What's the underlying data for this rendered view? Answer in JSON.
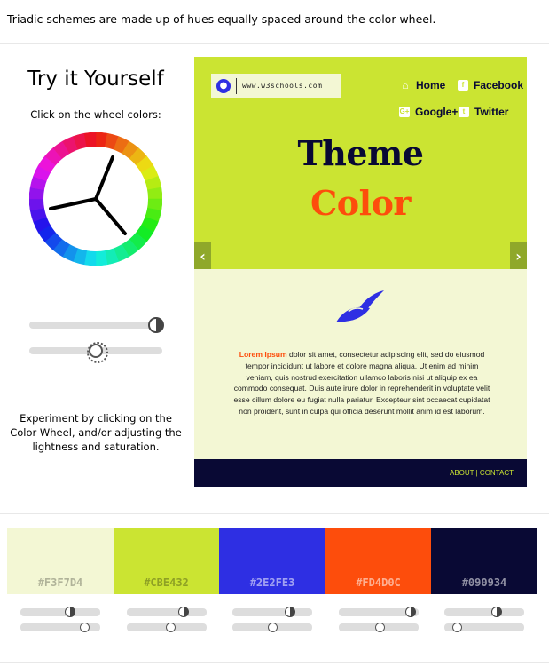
{
  "intro_text": "Triadic schemes are made up of hues equally spaced around the color wheel.",
  "left_panel": {
    "title": "Try it Yourself",
    "instruction": "Click on the wheel colors:",
    "lightness_level": 0.95,
    "saturation_level": 0.5,
    "experiment_text": "Experiment by clicking on the Color Wheel, and/or adjusting the lightness and saturation."
  },
  "preview": {
    "logo_text": "www.w3schools.com",
    "nav": {
      "home": "Home",
      "facebook": "Facebook",
      "googleplus": "Google+",
      "twitter": "Twitter"
    },
    "heading_line1": "Theme",
    "heading_line2": "Color",
    "prev_arrow": "‹",
    "next_arrow": "›",
    "lorem_bold": "Lorem Ipsum",
    "lorem_body": " dolor sit amet, consectetur adipiscing elit, sed do eiusmod tempor incididunt ut labore et dolore magna aliqua. Ut enim ad minim veniam, quis nostrud exercitation ullamco laboris nisi ut aliquip ex ea commodo consequat. Duis aute irure dolor in reprehenderit in voluptate velit esse cillum dolore eu fugiat nulla pariatur. Excepteur sint occaecat cupidatat non proident, sunt in culpa qui officia deserunt mollit anim id est laborum.",
    "footer_links": "ABOUT | CONTACT"
  },
  "swatches": [
    {
      "hex": "#F3F7D4",
      "label": "#F3F7D4",
      "label_color": "#7a7c6a",
      "lightness_level": 0.62,
      "saturation_level": 0.8
    },
    {
      "hex": "#CBE432",
      "label": "#CBE432",
      "label_color": "#5e6a1a",
      "lightness_level": 0.72,
      "saturation_level": 0.55
    },
    {
      "hex": "#2E2FE3",
      "label": "#2E2FE3",
      "label_color": "#ffffff",
      "lightness_level": 0.72,
      "saturation_level": 0.5
    },
    {
      "hex": "#FD4D0C",
      "label": "#FD4D0C",
      "label_color": "#ffffff",
      "lightness_level": 0.9,
      "saturation_level": 0.52
    },
    {
      "hex": "#090934",
      "label": "#090934",
      "label_color": "#ffffff",
      "lightness_level": 0.65,
      "saturation_level": 0.16
    }
  ],
  "colors": {
    "accent_lime": "#CBE432",
    "light_cream": "#F3F7D4",
    "blue": "#2E2FE3",
    "orange": "#FD4D0C",
    "navy": "#090934"
  },
  "icons": [
    "globe-icon",
    "home-icon",
    "facebook-icon",
    "google-plus-icon",
    "twitter-icon",
    "bird-logo-icon",
    "contrast-icon",
    "brightness-icon"
  ]
}
